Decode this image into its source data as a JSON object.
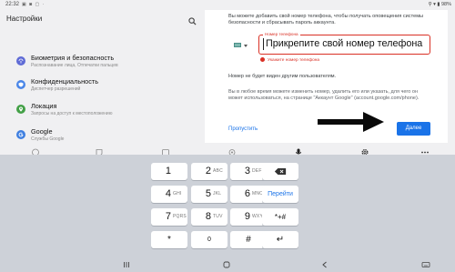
{
  "status_bar": {
    "time": "22:32",
    "notification_icons": "▣ ◙ ▢ ·",
    "right": "⚲ ▾ ▮ 98%"
  },
  "settings": {
    "title": "Настройки",
    "items": [
      {
        "name": "Биометрия и безопасность",
        "sub": "Распознавание лица, Отпечатки пальцев",
        "icon": "fingerprint-icon",
        "color": "#5f6bd6"
      },
      {
        "name": "Конфиденциальность",
        "sub": "Диспетчер разрешений",
        "icon": "privacy-shield-icon",
        "color": "#4a86e8"
      },
      {
        "name": "Локация",
        "sub": "Запросы на доступ к местоположению",
        "icon": "location-pin-icon",
        "color": "#43a047"
      },
      {
        "name": "Google",
        "sub": "Службы Google",
        "icon": "google-g-icon",
        "color": "#3f7fe0"
      }
    ]
  },
  "dialog": {
    "intro": "Вы можете добавить свой номер телефона, чтобы получать оповещения системы безопасности и сбрасывать пароль аккаунта.",
    "phone_label": "Номер телефона",
    "phone_value": "Прикрепите свой номер телефона",
    "error": "Укажите номер телефона",
    "not_visible": "Номер не будет виден другим пользователям.",
    "info": "Вы в любое время можете изменить номер, удалить его или указать, для чего он может использоваться, на странице \"Аккаунт Google\" (account.google.com/phone).",
    "skip_label": "Пропустить",
    "next_label": "Далее",
    "accent_color": "#1a73e8",
    "error_color": "#d93025"
  },
  "keyboard": {
    "rows": [
      [
        {
          "num": "1",
          "letters": ""
        },
        {
          "num": "2",
          "letters": "ABC"
        },
        {
          "num": "3",
          "letters": "DEF"
        },
        {
          "action": "backspace-icon"
        }
      ],
      [
        {
          "num": "4",
          "letters": "GHI"
        },
        {
          "num": "5",
          "letters": "JKL"
        },
        {
          "num": "6",
          "letters": "MNO"
        },
        {
          "action": "go",
          "label": "Перейти"
        }
      ],
      [
        {
          "num": "7",
          "letters": "PQRS"
        },
        {
          "num": "8",
          "letters": "TUV"
        },
        {
          "num": "9",
          "letters": "WXYZ"
        },
        {
          "label": "*+#"
        }
      ],
      [
        {
          "label": "*"
        },
        {
          "label": "0"
        },
        {
          "label": "#"
        },
        {
          "label": "↵"
        }
      ]
    ]
  }
}
